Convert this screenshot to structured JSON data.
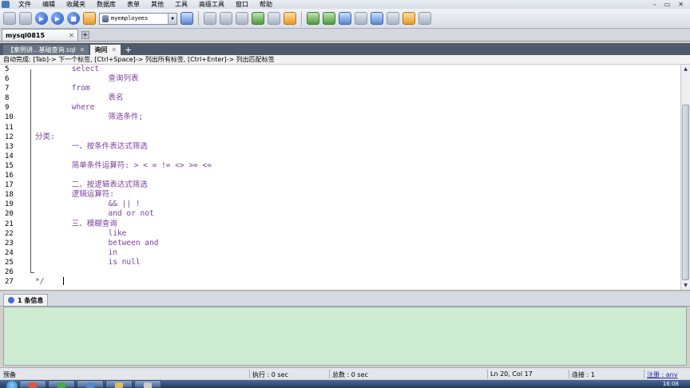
{
  "menubar": {
    "items": [
      "文件",
      "编辑",
      "收藏夹",
      "数据库",
      "表单",
      "其他",
      "工具",
      "高级工具",
      "窗口",
      "帮助"
    ],
    "window_controls": [
      "–",
      "▭",
      "✕"
    ]
  },
  "toolbar": {
    "database_selector": "myemployees"
  },
  "connection_tab": {
    "label": "mysql0815",
    "close": "✕",
    "add": "+"
  },
  "query_tabs": [
    {
      "label": "【案例讲...基础查询.sql",
      "active": false
    },
    {
      "label": "询问",
      "active": true
    }
  ],
  "query_tab_close": "✕",
  "query_tab_add": "+",
  "hint_bar": "自动完成: [Tab]-> 下一个标签, [Ctrl+Space]-> 列出所有标签, [Ctrl+Enter]-> 列出匹配标签",
  "editor": {
    "lines": [
      {
        "n": "5",
        "text": "        select"
      },
      {
        "n": "6",
        "text": "                查询列表"
      },
      {
        "n": "7",
        "text": "        from"
      },
      {
        "n": "8",
        "text": "                表名"
      },
      {
        "n": "9",
        "text": "        where"
      },
      {
        "n": "10",
        "text": "                筛选条件;"
      },
      {
        "n": "11",
        "text": ""
      },
      {
        "n": "12",
        "text": "分类:"
      },
      {
        "n": "13",
        "text": "        一、按条件表达式筛选"
      },
      {
        "n": "14",
        "text": ""
      },
      {
        "n": "15",
        "text": "        简单条件运算符: > < = != <> >= <="
      },
      {
        "n": "16",
        "text": ""
      },
      {
        "n": "17",
        "text": "        二、按逻辑表达式筛选"
      },
      {
        "n": "18",
        "text": "        逻辑运算符:"
      },
      {
        "n": "19",
        "text": "                && || !"
      },
      {
        "n": "20",
        "text": "                and or not"
      },
      {
        "n": "21",
        "text": "        三、模糊查询"
      },
      {
        "n": "22",
        "text": "                like"
      },
      {
        "n": "23",
        "text": "                between and"
      },
      {
        "n": "24",
        "text": "                in"
      },
      {
        "n": "25",
        "text": "                is null"
      },
      {
        "n": "26",
        "text": ""
      },
      {
        "n": "27",
        "text": "*/"
      }
    ]
  },
  "messages": {
    "tab_label": "1 条信息"
  },
  "status": {
    "left": "预备",
    "exec": "执行 : 0 sec",
    "total": "总数 : 0 sec",
    "position": "Ln 20, Col 17",
    "connections": "连接 : 1",
    "register": "注册 : anv"
  },
  "taskbar": {
    "time": "16:08"
  },
  "colors": {
    "code_text": "#7a3e9d",
    "message_pane": "#cdebd0",
    "query_tabstrip": "#4e5a6a"
  }
}
